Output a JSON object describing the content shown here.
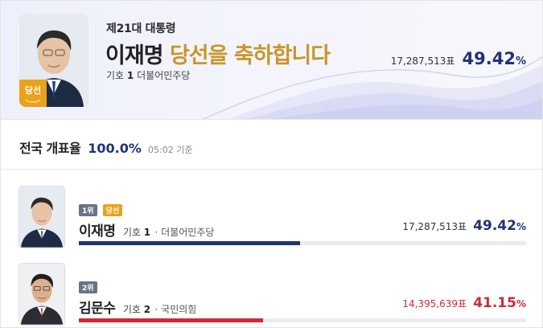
{
  "colors": {
    "blue": "#1e3475",
    "red": "#cf2a36",
    "gold": "#e9a21a",
    "gray_tag": "#6a7386"
  },
  "hero": {
    "subtitle": "제21대 대통령",
    "name": "이재명",
    "congrats": "당선을 축하합니다",
    "number_label": "기호",
    "number": "1",
    "party": "더불어민주당",
    "badge": "당선",
    "votes": "17,287,513표",
    "percent": "49.42",
    "percent_sign": "%"
  },
  "count": {
    "label": "전국 개표율",
    "value": "100.0%",
    "time": "05:02 기준"
  },
  "candidates": [
    {
      "rank": "1위",
      "elected": "당선",
      "name": "이재명",
      "number_label": "기호",
      "number": "1",
      "party": "· 더불어민주당",
      "votes": "17,287,513표",
      "percent": "49.42",
      "percent_sign": "%",
      "share": 49.42
    },
    {
      "rank": "2위",
      "name": "김문수",
      "number_label": "기호",
      "number": "2",
      "party": "· 국민의힘",
      "votes": "14,395,639표",
      "percent": "41.15",
      "percent_sign": "%",
      "share": 41.15
    }
  ]
}
